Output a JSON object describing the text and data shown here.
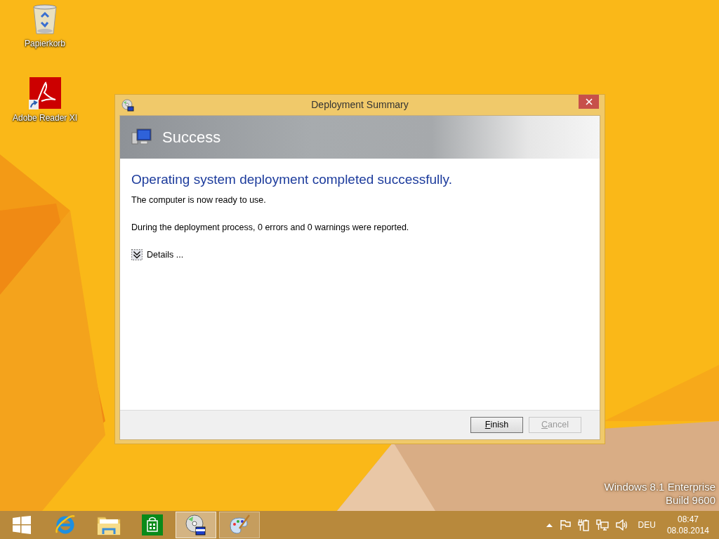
{
  "desktop_icons": [
    {
      "kind": "recycle-bin",
      "label": "Papierkorb"
    },
    {
      "kind": "pdf-shortcut",
      "label": "Adobe Reader XI"
    }
  ],
  "window": {
    "title": "Deployment Summary",
    "banner": "Success",
    "heading": "Operating system deployment completed successfully.",
    "message": "The computer is now ready to use.",
    "summary": "During the deployment process, 0 errors and 0 warnings were reported.",
    "details": {
      "label": "Details ...",
      "expanded": false
    },
    "buttons": [
      {
        "label": "Finish",
        "disabled": false
      },
      {
        "label": "Cancel",
        "disabled": true
      }
    ]
  },
  "os_watermark": [
    "Windows 8.1 Enterprise",
    "Build 9600"
  ],
  "taskbar": {
    "items": [
      {
        "kind": "start",
        "selected": false,
        "running": false
      },
      {
        "kind": "browser",
        "selected": false,
        "running": false
      },
      {
        "kind": "folder",
        "selected": false,
        "running": false
      },
      {
        "kind": "store",
        "selected": false,
        "running": false
      },
      {
        "kind": "disc",
        "selected": true,
        "running": true
      },
      {
        "kind": "palette",
        "selected": false,
        "running": true
      }
    ],
    "tray": {
      "language": "DEU",
      "time": "08:47",
      "date": "08.08.2014"
    }
  }
}
